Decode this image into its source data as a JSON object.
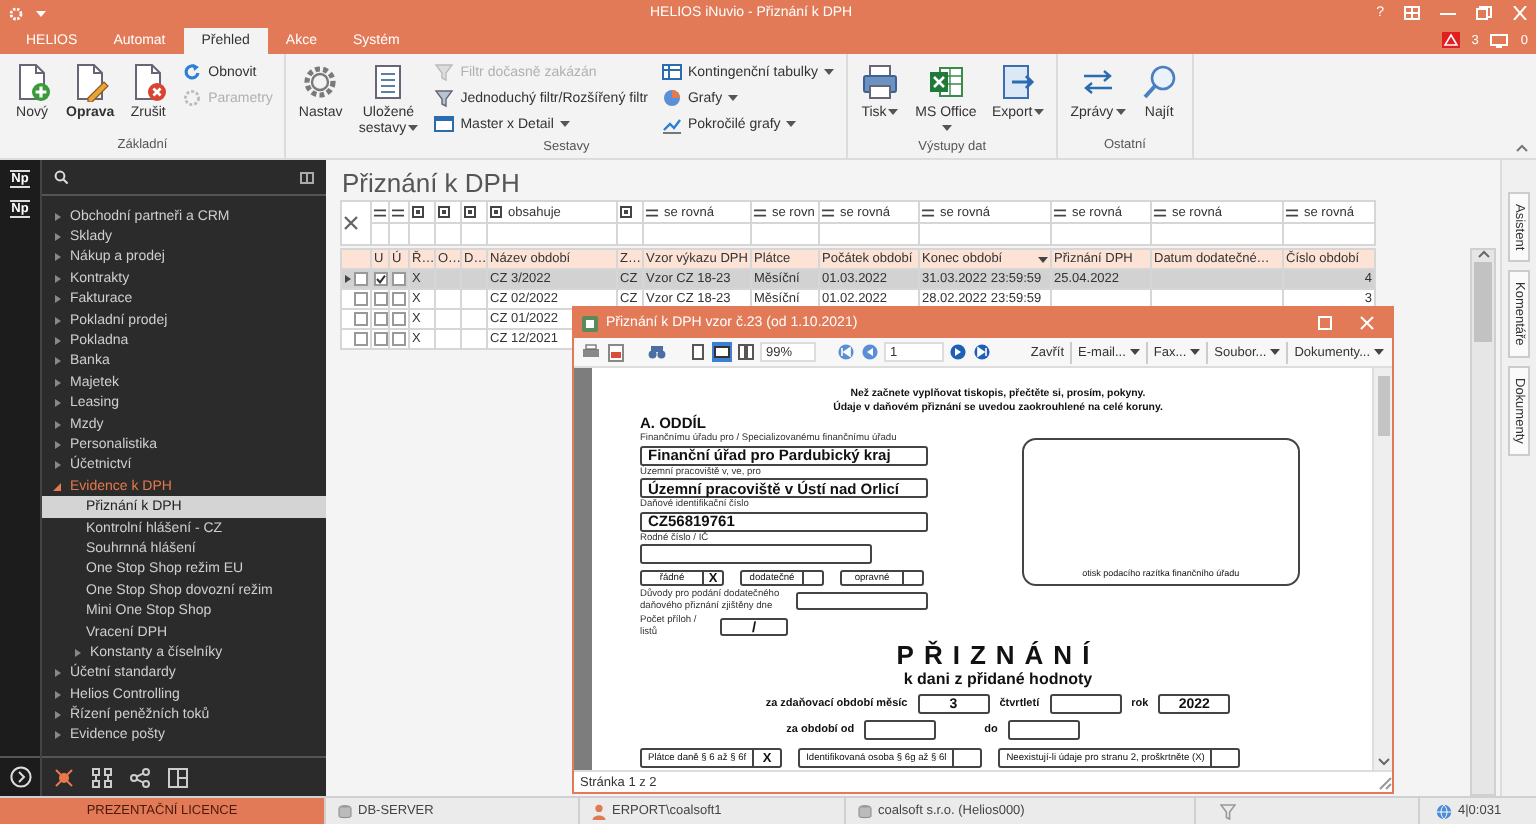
{
  "window": {
    "title": "HELIOS iNuvio - Přiznání k DPH",
    "help_button": "?",
    "alert_count": "3",
    "monitor_count": "0"
  },
  "ribbon_tabs": [
    {
      "label": "HELIOS",
      "selected": false
    },
    {
      "label": "Automat",
      "selected": false
    },
    {
      "label": "Přehled",
      "selected": true
    },
    {
      "label": "Akce",
      "selected": false
    },
    {
      "label": "Systém",
      "selected": false
    }
  ],
  "ribbon_groups": [
    {
      "title": "Základní",
      "items": [
        {
          "kind": "large",
          "label": "Nový",
          "dropdown": false,
          "disabled": false,
          "emphasized": false
        },
        {
          "kind": "large",
          "label": "Oprava",
          "dropdown": false,
          "disabled": false,
          "emphasized": true
        },
        {
          "kind": "large",
          "label": "Zrušit",
          "dropdown": false,
          "disabled": false,
          "emphasized": false
        },
        {
          "kind": "small",
          "label": "Obnovit",
          "dropdown": false,
          "disabled": false,
          "emphasized": false
        },
        {
          "kind": "small",
          "label": "Parametry",
          "dropdown": false,
          "disabled": true,
          "emphasized": false
        }
      ]
    },
    {
      "title": "Sestavy",
      "items": [
        {
          "kind": "large",
          "label": "Nastav",
          "dropdown": false,
          "disabled": false,
          "emphasized": false
        },
        {
          "kind": "large",
          "label": "Uložené sestavy",
          "dropdown": true,
          "disabled": false,
          "emphasized": false
        },
        {
          "kind": "small",
          "label": "Filtr dočasně zakázán",
          "dropdown": false,
          "disabled": true,
          "emphasized": false
        },
        {
          "kind": "small",
          "label": "Jednoduchý filtr/Rozšířený filtr",
          "dropdown": false,
          "disabled": false,
          "emphasized": false
        },
        {
          "kind": "small",
          "label": "Master x Detail",
          "dropdown": true,
          "disabled": false,
          "emphasized": false
        },
        {
          "kind": "small",
          "label": "Kontingenční tabulky",
          "dropdown": true,
          "disabled": false,
          "emphasized": false
        },
        {
          "kind": "small",
          "label": "Grafy",
          "dropdown": true,
          "disabled": false,
          "emphasized": false
        },
        {
          "kind": "small",
          "label": "Pokročilé grafy",
          "dropdown": true,
          "disabled": false,
          "emphasized": false
        }
      ]
    },
    {
      "title": "Výstupy dat",
      "items": [
        {
          "kind": "large",
          "label": "Tisk",
          "dropdown": true,
          "disabled": false,
          "emphasized": false
        },
        {
          "kind": "large",
          "label": "MS Office",
          "dropdown": true,
          "disabled": false,
          "emphasized": false
        },
        {
          "kind": "large",
          "label": "Export",
          "dropdown": true,
          "disabled": false,
          "emphasized": false
        }
      ]
    },
    {
      "title": "Ostatní",
      "items": [
        {
          "kind": "large",
          "label": "Zprávy",
          "dropdown": true,
          "disabled": false,
          "emphasized": false
        },
        {
          "kind": "large",
          "label": "Najít",
          "dropdown": false,
          "disabled": false,
          "emphasized": false
        }
      ]
    }
  ],
  "sidebar": {
    "rail_badges": [
      "Np",
      "Np"
    ],
    "items": [
      {
        "label": "Obchodní partneři a CRM",
        "expanded": false
      },
      {
        "label": "Sklady",
        "expanded": false
      },
      {
        "label": "Nákup a prodej",
        "expanded": false
      },
      {
        "label": "Kontrakty",
        "expanded": false
      },
      {
        "label": "Fakturace",
        "expanded": false
      },
      {
        "label": "Pokladní prodej",
        "expanded": false
      },
      {
        "label": "Pokladna",
        "expanded": false
      },
      {
        "label": "Banka",
        "expanded": false
      },
      {
        "label": "Majetek",
        "expanded": false
      },
      {
        "label": "Leasing",
        "expanded": false
      },
      {
        "label": "Mzdy",
        "expanded": false
      },
      {
        "label": "Personalistika",
        "expanded": false
      },
      {
        "label": "Účetnictví",
        "expanded": false
      },
      {
        "label": "Evidence k DPH",
        "expanded": true,
        "children": [
          {
            "label": "Přiznání k DPH",
            "selected": true,
            "expandable": false
          },
          {
            "label": "Kontrolní hlášení - CZ",
            "selected": false,
            "expandable": false
          },
          {
            "label": "Souhrnná hlášení",
            "selected": false,
            "expandable": false
          },
          {
            "label": "One Stop Shop režim EU",
            "selected": false,
            "expandable": false
          },
          {
            "label": "One Stop Shop dovozní režim",
            "selected": false,
            "expandable": false
          },
          {
            "label": "Mini One Stop Shop",
            "selected": false,
            "expandable": false
          },
          {
            "label": "Vracení DPH",
            "selected": false,
            "expandable": false
          },
          {
            "label": "Konstanty a číselníky",
            "selected": false,
            "expandable": true
          }
        ]
      },
      {
        "label": "Účetní standardy",
        "expanded": false
      },
      {
        "label": "Helios Controlling",
        "expanded": false
      },
      {
        "label": "Řízení peněžních toků",
        "expanded": false
      },
      {
        "label": "Evidence pošty",
        "expanded": false
      }
    ]
  },
  "page": {
    "heading": "Přiznání k DPH"
  },
  "table": {
    "columns": [
      {
        "label": "U",
        "kind": "checkbox",
        "filter": {
          "kind": "equals"
        }
      },
      {
        "label": "Ú",
        "kind": "checkbox",
        "filter": {
          "kind": "equals"
        }
      },
      {
        "label": "Ř…",
        "kind": "text",
        "filter": {
          "kind": "operator"
        }
      },
      {
        "label": "O…",
        "kind": "text",
        "filter": {
          "kind": "operator"
        }
      },
      {
        "label": "D…",
        "kind": "text",
        "filter": {
          "kind": "operator"
        }
      },
      {
        "label": "Název období",
        "kind": "text",
        "filter": {
          "kind": "operator",
          "text": "obsahuje"
        }
      },
      {
        "label": "Z…",
        "kind": "text",
        "filter": {
          "kind": "operator"
        }
      },
      {
        "label": "Vzor výkazu DPH",
        "kind": "text",
        "filter": {
          "kind": "equals",
          "text": "se rovná"
        }
      },
      {
        "label": "Plátce",
        "kind": "text",
        "filter": {
          "kind": "equals",
          "text": "se rovn"
        }
      },
      {
        "label": "Počátek období",
        "kind": "text",
        "filter": {
          "kind": "equals",
          "text": "se rovná"
        }
      },
      {
        "label": "Konec období",
        "kind": "text",
        "sorted": true,
        "filter": {
          "kind": "equals",
          "text": "se rovná"
        }
      },
      {
        "label": "Přiznání DPH",
        "kind": "text",
        "filter": {
          "kind": "equals",
          "text": "se rovná"
        }
      },
      {
        "label": "Datum dodatečné…",
        "kind": "text",
        "filter": {
          "kind": "equals",
          "text": "se rovná"
        }
      },
      {
        "label": "Číslo období",
        "kind": "number",
        "filter": {
          "kind": "equals",
          "text": "se rovná"
        }
      }
    ],
    "rows": [
      {
        "selected": true,
        "current": true,
        "marked": false,
        "cells": [
          true,
          false,
          "X",
          null,
          null,
          "CZ 3/2022",
          "CZ",
          "Vzor CZ 18-23",
          "Měsíční",
          "01.03.2022",
          "31.03.2022 23:59:59",
          "25.04.2022",
          null,
          "4"
        ]
      },
      {
        "selected": false,
        "current": false,
        "marked": false,
        "cells": [
          false,
          false,
          "X",
          null,
          null,
          "CZ 02/2022",
          "CZ",
          "Vzor CZ 18-23",
          "Měsíční",
          "01.02.2022",
          "28.02.2022 23:59:59",
          null,
          null,
          "3"
        ]
      },
      {
        "selected": false,
        "current": false,
        "marked": false,
        "cells": [
          false,
          false,
          "X",
          null,
          null,
          "CZ 01/2022"
        ]
      },
      {
        "selected": false,
        "current": false,
        "marked": false,
        "cells": [
          false,
          false,
          "X",
          null,
          null,
          "CZ 12/2021"
        ]
      }
    ]
  },
  "side_tabs": [
    "Asistent",
    "Komentáře",
    "Dokumenty"
  ],
  "dialog": {
    "title": "Přiznání k DPH vzor č.23 (od 1.10.2021)",
    "view_modes": [
      {
        "selected": false
      },
      {
        "selected": true
      },
      {
        "selected": false
      }
    ],
    "zoom": "99%",
    "page_number": "1",
    "menu_buttons": [
      {
        "label": "Zavřít",
        "dropdown": false
      },
      {
        "label": "E-mail...",
        "dropdown": true
      },
      {
        "label": "Fax...",
        "dropdown": true
      },
      {
        "label": "Soubor...",
        "dropdown": true
      },
      {
        "label": "Dokumenty...",
        "dropdown": true
      }
    ],
    "status": "Stránka 1 z 2",
    "document": {
      "notice": [
        "Než začnete vyplňovat tiskopis, přečtěte si, prosím, pokyny.",
        "Údaje v daňovém přiznání se uvedou zaokrouhlené na celé koruny."
      ],
      "section": "A. ODDÍL",
      "fields": [
        {
          "label": "Finančnímu úřadu pro / Specializovanému finančnímu úřadu",
          "value": "Finanční úřad pro Pardubický kraj"
        },
        {
          "label": "Územní pracoviště v, ve, pro",
          "value": "Územní pracoviště v Ústí nad Orlicí"
        },
        {
          "label": "Daňové identifikační číslo",
          "value": "CZ56819761"
        },
        {
          "label": "Rodné číslo / IČ"
        }
      ],
      "filing_types": [
        {
          "label": "řádné",
          "value": "X"
        },
        {
          "label": "dodatečné"
        },
        {
          "label": "opravné"
        }
      ],
      "reason_label": "Důvody pro podání dodatečného daňového přiznání zjištěny dne",
      "attachments": {
        "label": "Počet příloh / listů",
        "value": "/"
      },
      "stamp_caption": "otisk podacího razítka finančního úřadu",
      "heading": "PŘIZNÁNÍ",
      "subheading": "k dani z přidané hodnoty",
      "period": {
        "label": "za zdaňovací období měsíc",
        "month": "3",
        "quarter_label": "čtvrtletí",
        "year_label": "rok",
        "year": "2022",
        "from_label": "za období od",
        "to_label": "do"
      },
      "taxpayer_types": [
        {
          "label": "Plátce daně § 6 až § 6f",
          "value": "X"
        },
        {
          "label": "Identifikovaná osoba § 6g až § 6l"
        },
        {
          "label": "Neexistují-li údaje pro stranu 2, proškrtněte (X)"
        }
      ]
    }
  },
  "status_bar": {
    "license": "PREZENTAČNÍ LICENCE",
    "server": "DB-SERVER",
    "user": "ERPORT\\coalsoft1",
    "company": "coalsoft s.r.o. (Helios000)",
    "counter": "4|0:031"
  }
}
